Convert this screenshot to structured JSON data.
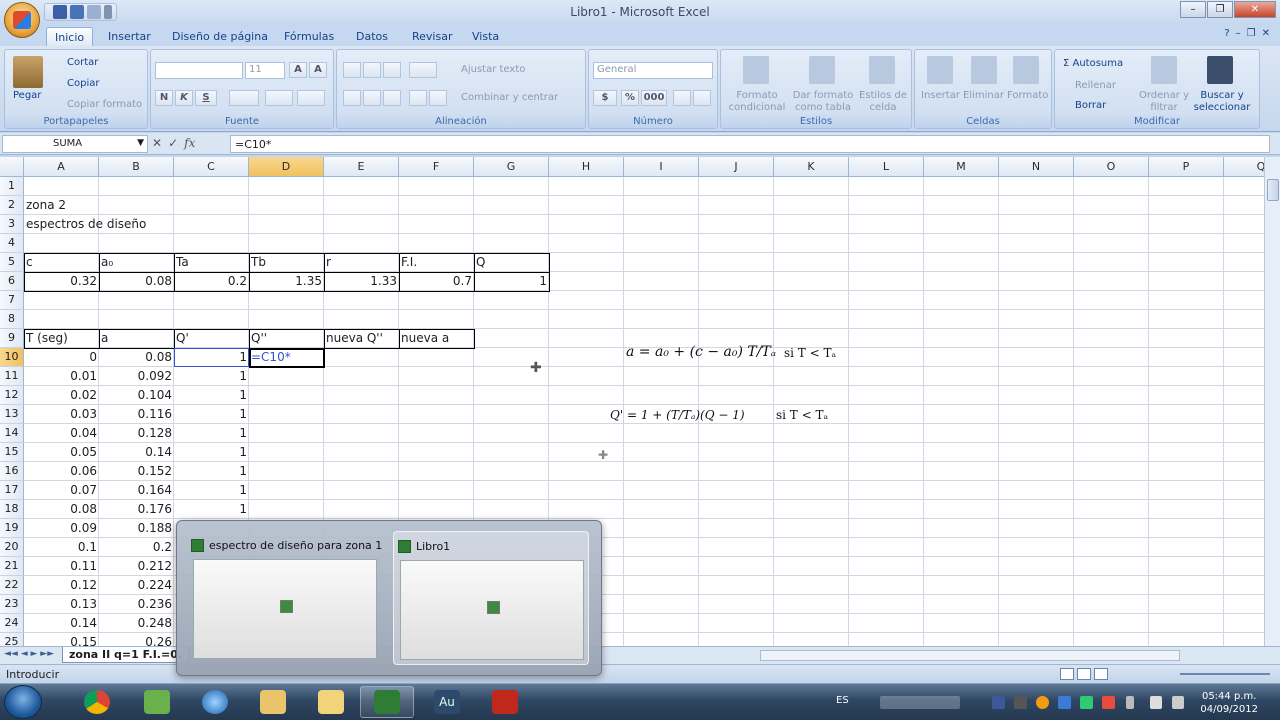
{
  "window": {
    "title": "Libro1 - Microsoft Excel",
    "controls": [
      "–",
      "❐",
      "✕"
    ]
  },
  "ribbon_tabs": [
    "Inicio",
    "Insertar",
    "Diseño de página",
    "Fórmulas",
    "Datos",
    "Revisar",
    "Vista"
  ],
  "ribbon": {
    "clipboard": {
      "label": "Portapapeles",
      "paste": "Pegar",
      "cut": "Cortar",
      "copy": "Copiar",
      "format_painter": "Copiar formato"
    },
    "font": {
      "label": "Fuente",
      "size": "11",
      "bold": "N",
      "italic": "K",
      "underline": "S"
    },
    "alignment": {
      "label": "Alineación",
      "wrap": "Ajustar texto",
      "merge": "Combinar y centrar"
    },
    "number": {
      "label": "Número",
      "format": "General",
      "currency": "$",
      "percent": "%",
      "thousands": "000"
    },
    "styles": {
      "label": "Estilos",
      "conditional": "Formato condicional",
      "as_table": "Dar formato como tabla",
      "cell_styles": "Estilos de celda"
    },
    "cells": {
      "label": "Celdas",
      "insert": "Insertar",
      "delete": "Eliminar",
      "format": "Formato"
    },
    "editing": {
      "label": "Modificar",
      "autosum": "Autosuma",
      "fill": "Rellenar",
      "clear": "Borrar",
      "sort": "Ordenar y filtrar",
      "find": "Buscar y seleccionar"
    }
  },
  "formula_bar": {
    "name_box": "SUMA",
    "cancel": "✕",
    "enter": "✓",
    "fx": "fx",
    "formula": "=C10*"
  },
  "columns": [
    "A",
    "B",
    "C",
    "D",
    "E",
    "F",
    "G",
    "H",
    "I",
    "J",
    "K",
    "L",
    "M",
    "N",
    "O",
    "P",
    "Q"
  ],
  "rows": [
    "1",
    "2",
    "3",
    "4",
    "5",
    "6",
    "7",
    "8",
    "9",
    "10",
    "11",
    "12",
    "13",
    "14",
    "15",
    "16",
    "17",
    "18",
    "19",
    "20",
    "21",
    "22",
    "23",
    "24",
    "25"
  ],
  "cells": {
    "A2": "zona 2",
    "A3": "espectros de diseño",
    "header5": [
      "c",
      "a₀",
      "Ta",
      "Tb",
      "r",
      "F.I.",
      "Q"
    ],
    "values6": [
      "0.32",
      "0.08",
      "0.2",
      "1.35",
      "1.33",
      "0.7",
      "1"
    ],
    "header9": [
      "T (seg)",
      "a",
      "Q'",
      "Q''",
      "nueva Q''",
      "nueva a"
    ],
    "editing_cell": "=C10*"
  },
  "table_rows": [
    {
      "t": "0",
      "a": "0.08",
      "q": "1"
    },
    {
      "t": "0.01",
      "a": "0.092",
      "q": "1"
    },
    {
      "t": "0.02",
      "a": "0.104",
      "q": "1"
    },
    {
      "t": "0.03",
      "a": "0.116",
      "q": "1"
    },
    {
      "t": "0.04",
      "a": "0.128",
      "q": "1"
    },
    {
      "t": "0.05",
      "a": "0.14",
      "q": "1"
    },
    {
      "t": "0.06",
      "a": "0.152",
      "q": "1"
    },
    {
      "t": "0.07",
      "a": "0.164",
      "q": "1"
    },
    {
      "t": "0.08",
      "a": "0.176",
      "q": "1"
    },
    {
      "t": "0.09",
      "a": "0.188",
      "q": ""
    },
    {
      "t": "0.1",
      "a": "0.2",
      "q": ""
    },
    {
      "t": "0.11",
      "a": "0.212",
      "q": ""
    },
    {
      "t": "0.12",
      "a": "0.224",
      "q": ""
    },
    {
      "t": "0.13",
      "a": "0.236",
      "q": ""
    },
    {
      "t": "0.14",
      "a": "0.248",
      "q": ""
    },
    {
      "t": "0.15",
      "a": "0.26",
      "q": ""
    }
  ],
  "equations": {
    "eq1": "a = a₀ + (c − a₀) T/Tₐ",
    "eq1_cond": "si T < Tₐ",
    "eq2": "Q' = 1 + (T/Tₐ)(Q − 1)",
    "eq2_cond": "si T < Tₐ"
  },
  "sheet_tab": "zona II q=1 F.I.=0.",
  "status": "Introducir",
  "thumbnails": [
    {
      "title": "espectro de diseño para zona 1"
    },
    {
      "title": "Libro1"
    }
  ],
  "taskbar": {
    "lang": "ES",
    "time": "05:44 p.m.",
    "date": "04/09/2012",
    "au_label": "Au"
  }
}
